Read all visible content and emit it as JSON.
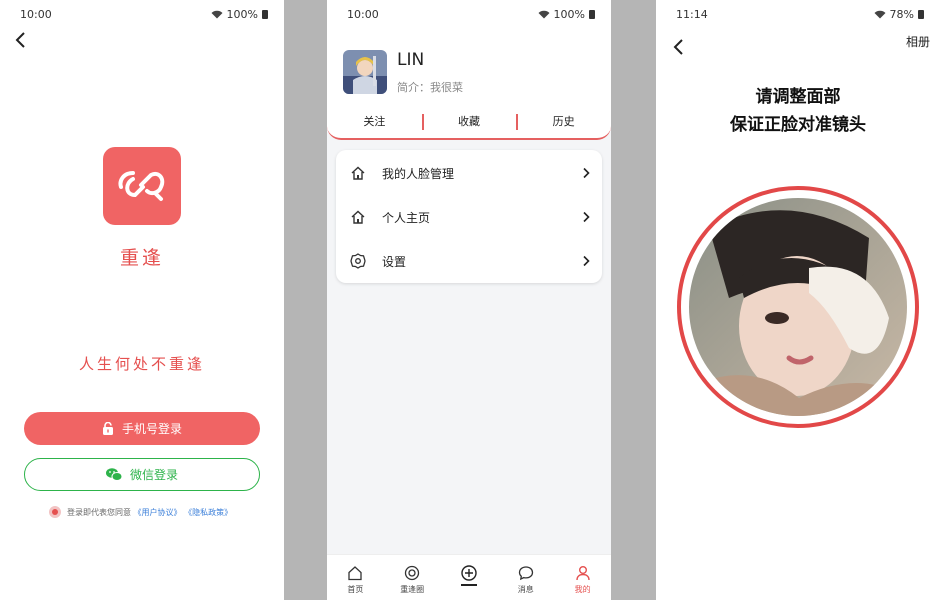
{
  "colors": {
    "brand_red": "#f06464",
    "wechat_green": "#2db34a",
    "link_blue": "#3b7fd9",
    "ring_red": "#e24848"
  },
  "login_screen": {
    "status_time": "10:00",
    "battery": "100%",
    "back_icon": "back-arrow-icon",
    "app_name": "重逢",
    "slogan": "人生何处不重逢",
    "phone_login": "手机号登录",
    "wechat_login": "微信登录",
    "agreement_prefix": "登录即代表您同意",
    "user_agreement": "《用户协议》",
    "privacy_policy": "《隐私政策》"
  },
  "profile_screen": {
    "status_time": "10:00",
    "battery": "100%",
    "username": "LIN",
    "bio": "简介：我很菜",
    "tabs": [
      "关注",
      "收藏",
      "历史"
    ],
    "menu": [
      {
        "label": "我的人脸管理",
        "icon": "home-icon"
      },
      {
        "label": "个人主页",
        "icon": "home-icon"
      },
      {
        "label": "设置",
        "icon": "gear-icon"
      }
    ],
    "tabbar": [
      {
        "label": "首页",
        "icon": "home-icon"
      },
      {
        "label": "重逢圈",
        "icon": "circle-icon"
      },
      {
        "label": "",
        "icon": "plus-icon"
      },
      {
        "label": "消息",
        "icon": "chat-icon"
      },
      {
        "label": "我的",
        "icon": "user-icon",
        "active": true
      }
    ]
  },
  "face_screen": {
    "status_time": "11:14",
    "battery": "78%",
    "album": "相册",
    "instruction_line1": "请调整面部",
    "instruction_line2": "保证正脸对准镜头"
  }
}
